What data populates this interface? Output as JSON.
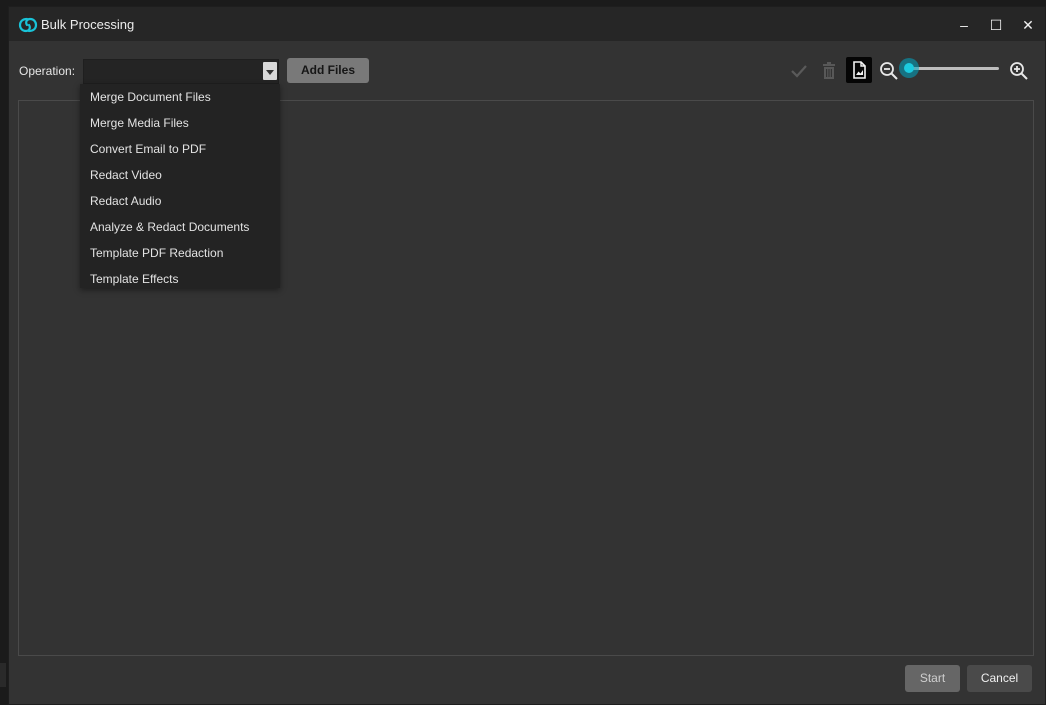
{
  "window": {
    "title": "Bulk Processing",
    "controls": {
      "minimize": "–",
      "maximize": "☐",
      "close": "✕"
    }
  },
  "toolbar": {
    "operation_label": "Operation:",
    "operation_value": "",
    "add_files_label": "Add Files",
    "icons": [
      "check-icon",
      "trash-icon",
      "image-document-icon",
      "zoom-out-icon",
      "zoom-in-icon"
    ],
    "zoom_level": 0
  },
  "operation_menu": {
    "items": [
      "Merge Document Files",
      "Merge Media Files",
      "Convert Email to PDF",
      "Redact Video",
      "Redact Audio",
      "Analyze & Redact Documents",
      "Template PDF Redaction",
      "Template Effects"
    ]
  },
  "footer": {
    "start_label": "Start",
    "cancel_label": "Cancel"
  },
  "colors": {
    "accent": "#1ccbe0",
    "background": "#333333",
    "titlebar": "#262626"
  }
}
